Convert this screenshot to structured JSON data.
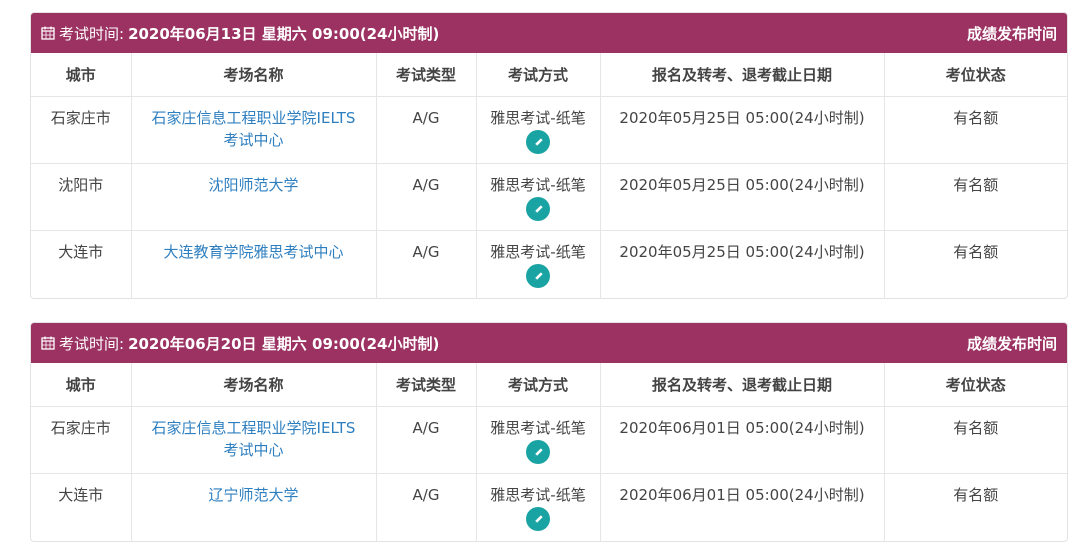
{
  "sessions": [
    {
      "label": "考试时间:",
      "datetime": "2020年06月13日 星期六 09:00(24小时制)",
      "result_link": "成绩发布时间",
      "columns": [
        "城市",
        "考场名称",
        "考试类型",
        "考试方式",
        "报名及转考、退考截止日期",
        "考位状态"
      ],
      "rows": [
        {
          "city": "石家庄市",
          "venue_line1": "石家庄信息工程职业学院IELTS",
          "venue_line2": "考试中心",
          "type": "A/G",
          "method": "雅思考试-纸笔",
          "deadline": "2020年05月25日 05:00(24小时制)",
          "status": "有名额"
        },
        {
          "city": "沈阳市",
          "venue_line1": "沈阳师范大学",
          "venue_line2": "",
          "type": "A/G",
          "method": "雅思考试-纸笔",
          "deadline": "2020年05月25日 05:00(24小时制)",
          "status": "有名额"
        },
        {
          "city": "大连市",
          "venue_line1": "大连教育学院雅思考试中心",
          "venue_line2": "",
          "type": "A/G",
          "method": "雅思考试-纸笔",
          "deadline": "2020年05月25日 05:00(24小时制)",
          "status": "有名额"
        }
      ]
    },
    {
      "label": "考试时间:",
      "datetime": "2020年06月20日 星期六 09:00(24小时制)",
      "result_link": "成绩发布时间",
      "columns": [
        "城市",
        "考场名称",
        "考试类型",
        "考试方式",
        "报名及转考、退考截止日期",
        "考位状态"
      ],
      "rows": [
        {
          "city": "石家庄市",
          "venue_line1": "石家庄信息工程职业学院IELTS",
          "venue_line2": "考试中心",
          "type": "A/G",
          "method": "雅思考试-纸笔",
          "deadline": "2020年06月01日 05:00(24小时制)",
          "status": "有名额"
        },
        {
          "city": "大连市",
          "venue_line1": "辽宁师范大学",
          "venue_line2": "",
          "type": "A/G",
          "method": "雅思考试-纸笔",
          "deadline": "2020年06月01日 05:00(24小时制)",
          "status": "有名额"
        }
      ]
    }
  ],
  "colors": {
    "header_bg": "#9b3262",
    "link": "#2e7fc0",
    "edit_button": "#1aa3a3"
  },
  "icons": {
    "header": "calendar-icon",
    "edit": "pencil-icon"
  }
}
